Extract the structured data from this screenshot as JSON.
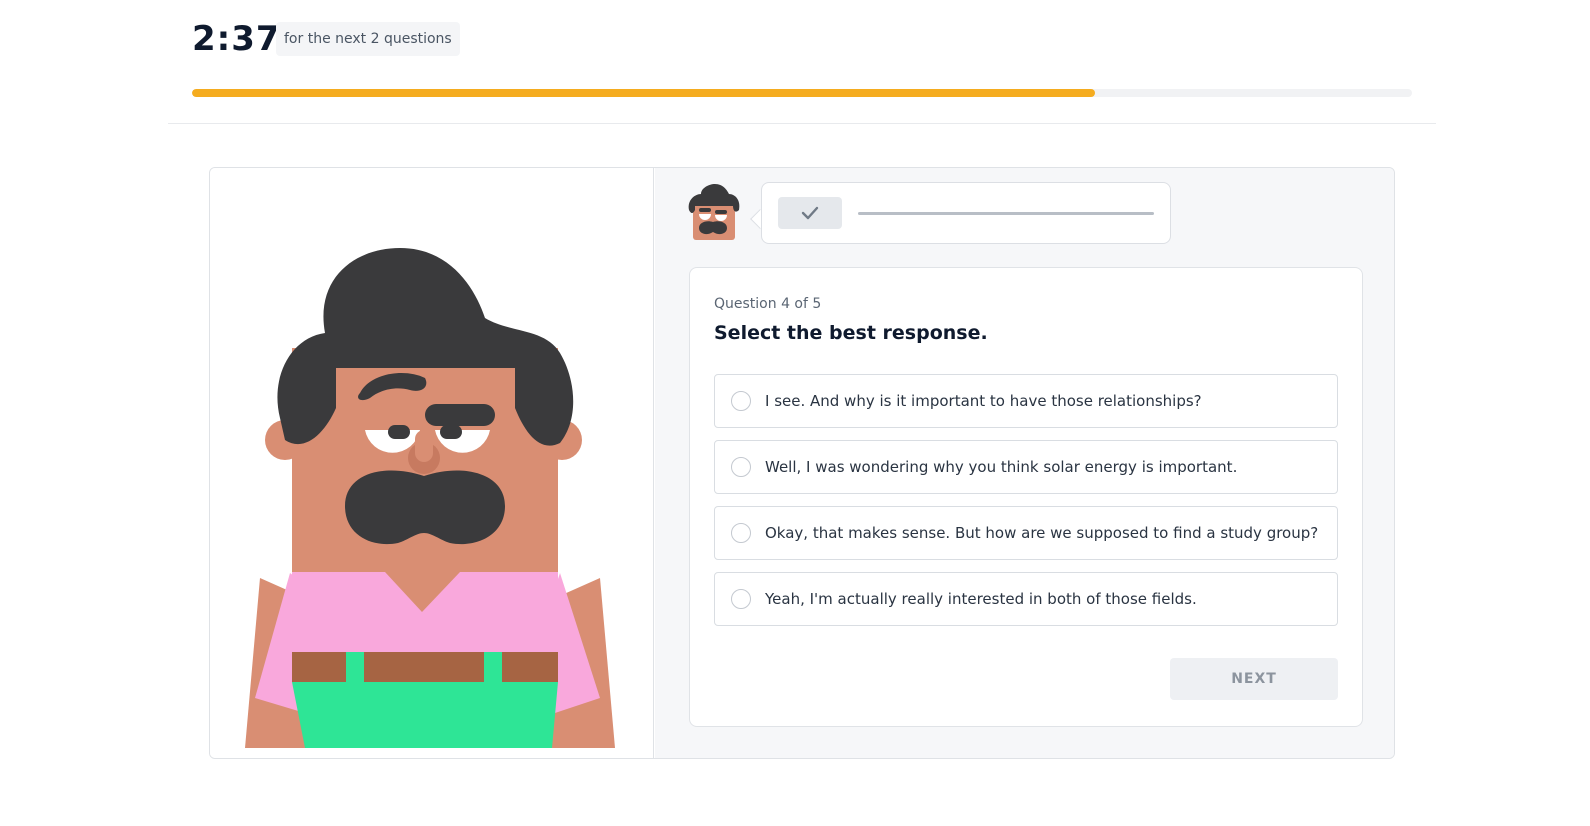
{
  "timer": {
    "time": "2:37",
    "note": "for the next 2 questions"
  },
  "progress": {
    "percent": 74
  },
  "question": {
    "counter": "Question 4 of 5",
    "title": "Select the best response.",
    "options": [
      "I see. And why is it important to have those relationships?",
      "Well, I was wondering why you think solar energy is important.",
      "Okay, that makes sense. But how are we supposed to find a study group?",
      "Yeah, I'm actually really interested in both of those fields."
    ],
    "next_label": "NEXT"
  },
  "colors": {
    "progress": "#f5ac1f",
    "hair": "#3a3a3c",
    "skin": "#d98e73",
    "shirt": "#f9a8dc",
    "belt": "#a66443",
    "pants": "#2ee596"
  },
  "icons": {
    "check": "check-icon",
    "avatar": "character-avatar"
  }
}
